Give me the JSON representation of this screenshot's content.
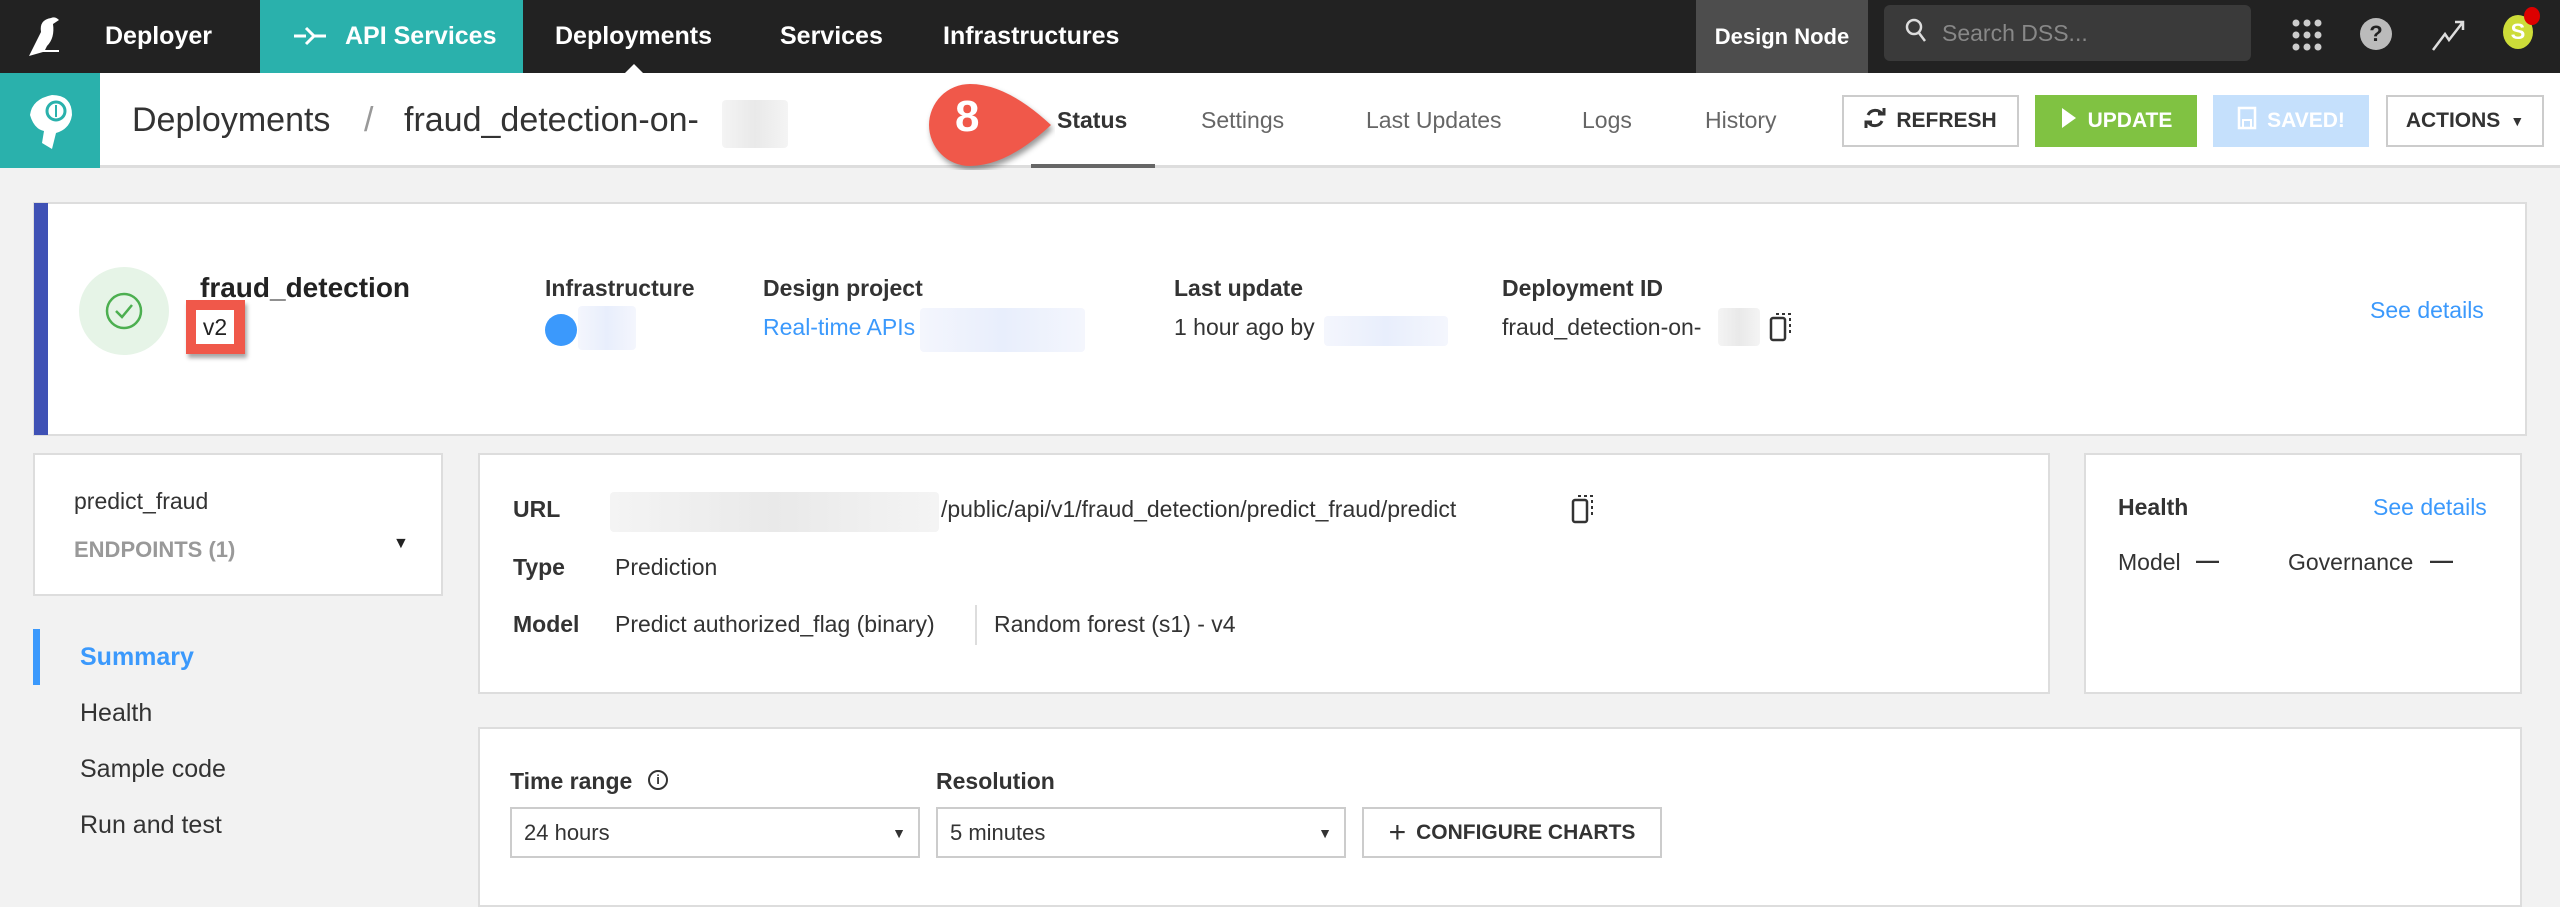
{
  "topbar": {
    "app_name": "Deployer",
    "nav": [
      {
        "label": "API Services",
        "icon": "api-icon",
        "active": true
      },
      {
        "label": "Deployments"
      },
      {
        "label": "Services"
      },
      {
        "label": "Infrastructures"
      }
    ],
    "node_label": "Design Node",
    "search_placeholder": "Search DSS...",
    "avatar_initial": "S",
    "colors": {
      "bar": "#222222",
      "accent": "#2ab1ac"
    }
  },
  "subheader": {
    "breadcrumb_root": "Deployments",
    "breadcrumb_sep": "/",
    "breadcrumb_current": "fraud_detection-on-",
    "step_marker": "8",
    "tabs": [
      "Status",
      "Settings",
      "Last Updates",
      "Logs",
      "History"
    ],
    "active_tab": "Status",
    "buttons": {
      "refresh": "REFRESH",
      "update": "UPDATE",
      "saved": "SAVED!",
      "actions": "ACTIONS"
    }
  },
  "deployment": {
    "name": "fraud_detection",
    "version": "v2",
    "infrastructure_label": "Infrastructure",
    "design_project_label": "Design project",
    "design_project_value": "Real-time APIs",
    "last_update_label": "Last update",
    "last_update_value": "1 hour ago by",
    "deployment_id_label": "Deployment ID",
    "deployment_id_value": "fraud_detection-on-",
    "see_details": "See details"
  },
  "endpoint_selector": {
    "name": "predict_fraud",
    "count_label": "ENDPOINTS (1)"
  },
  "side_nav": [
    "Summary",
    "Health",
    "Sample code",
    "Run and test"
  ],
  "side_nav_active": "Summary",
  "summary": {
    "url_label": "URL",
    "url_path": "/public/api/v1/fraud_detection/predict_fraud/predict",
    "type_label": "Type",
    "type_value": "Prediction",
    "model_label": "Model",
    "model_value": "Predict authorized_flag (binary)",
    "model_version": "Random forest (s1) - v4"
  },
  "health": {
    "title": "Health",
    "see_details": "See details",
    "model_label": "Model",
    "model_value": "—",
    "governance_label": "Governance",
    "governance_value": "—"
  },
  "charts": {
    "time_range_label": "Time range",
    "time_range_value": "24 hours",
    "resolution_label": "Resolution",
    "resolution_value": "5 minutes",
    "configure_label": "CONFIGURE CHARTS"
  }
}
